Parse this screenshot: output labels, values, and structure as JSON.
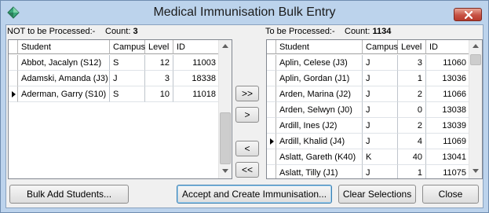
{
  "window": {
    "title": "Medical Immunisation Bulk Entry",
    "icon": "app-diamond-icon",
    "close_icon": "close-x-icon"
  },
  "left_panel": {
    "caption": "NOT to be Processed:-",
    "count_label": "Count:",
    "count_value": "3",
    "columns": [
      "Student",
      "Campus",
      "Level",
      "ID"
    ],
    "rows": [
      {
        "student": "Abbot, Jacalyn (S12)",
        "campus": "S",
        "level": "12",
        "id": "11003",
        "current": false
      },
      {
        "student": "Adamski, Amanda (J3)",
        "campus": "J",
        "level": "3",
        "id": "18338",
        "current": false
      },
      {
        "student": "Aderman, Garry (S10)",
        "campus": "S",
        "level": "10",
        "id": "11018",
        "current": true
      }
    ]
  },
  "right_panel": {
    "caption": "To be Processed:-",
    "count_label": "Count:",
    "count_value": "1134",
    "columns": [
      "Student",
      "Campus",
      "Level",
      "ID"
    ],
    "rows": [
      {
        "student": "Aplin, Celese (J3)",
        "campus": "J",
        "level": "3",
        "id": "11060",
        "current": false
      },
      {
        "student": "Aplin, Gordan (J1)",
        "campus": "J",
        "level": "1",
        "id": "13036",
        "current": false
      },
      {
        "student": "Arden, Marina (J2)",
        "campus": "J",
        "level": "2",
        "id": "11066",
        "current": false
      },
      {
        "student": "Arden, Selwyn (J0)",
        "campus": "J",
        "level": "0",
        "id": "13038",
        "current": false
      },
      {
        "student": "Ardill, Ines (J2)",
        "campus": "J",
        "level": "2",
        "id": "13039",
        "current": false
      },
      {
        "student": "Ardill, Khalid (J4)",
        "campus": "J",
        "level": "4",
        "id": "11069",
        "current": true
      },
      {
        "student": "Aslatt, Gareth (K40)",
        "campus": "K",
        "level": "40",
        "id": "13041",
        "current": false
      },
      {
        "student": "Aslatt, Tilly (J1)",
        "campus": "J",
        "level": "1",
        "id": "11075",
        "current": false
      }
    ]
  },
  "transfer_buttons": {
    "move_all_right": ">>",
    "move_right": ">",
    "move_left": "<",
    "move_all_left": "<<"
  },
  "footer": {
    "bulk_add": "Bulk Add Students...",
    "accept": "Accept and Create Immunisation...",
    "clear": "Clear Selections",
    "close": "Close"
  },
  "colors": {
    "frame": "#bcd3ec",
    "close_button": "#c75244",
    "client": "#f0f0f0",
    "grid_bg": "#ffffff",
    "focus_border": "#3c7fb1"
  }
}
